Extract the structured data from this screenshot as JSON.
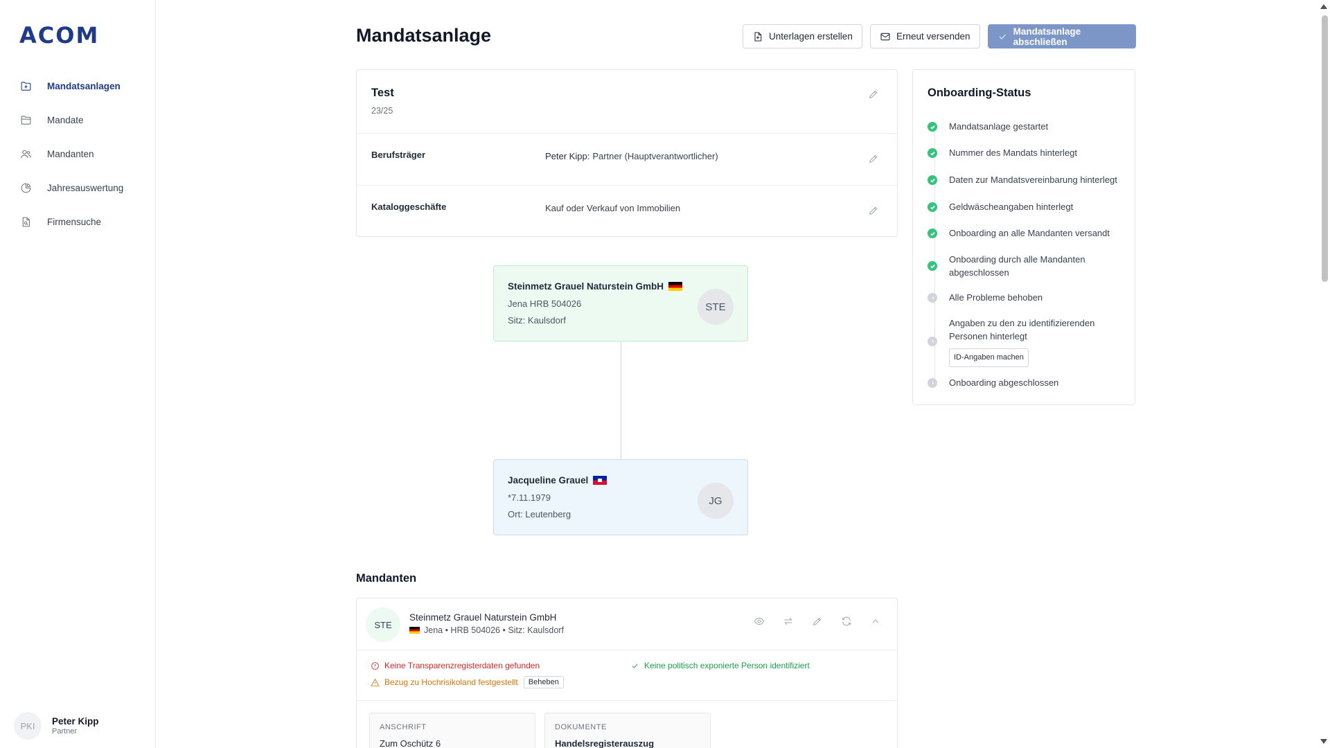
{
  "app": {
    "logo": "ACOM"
  },
  "sidebar": {
    "items": [
      {
        "label": "Mandatsanlagen",
        "icon": "folder-plus-icon",
        "active": true
      },
      {
        "label": "Mandate",
        "icon": "folder-icon"
      },
      {
        "label": "Mandanten",
        "icon": "users-icon"
      },
      {
        "label": "Jahresauswertung",
        "icon": "pie-chart-icon"
      },
      {
        "label": "Firmensuche",
        "icon": "document-search-icon"
      }
    ],
    "user": {
      "initials": "PKI",
      "name": "Peter Kipp",
      "role": "Partner"
    }
  },
  "header": {
    "title": "Mandatsanlage",
    "btn_create": "Unterlagen erstellen",
    "btn_resend": "Erneut versenden",
    "btn_finish": "Mandatsanlage abschließen"
  },
  "mandate": {
    "title": "Test",
    "number": "23/25",
    "rows": [
      {
        "label": "Berufsträger",
        "value_name": "Peter Kipp:",
        "value": "Partner (Hauptverantwortlicher)"
      },
      {
        "label": "Kataloggeschäfte",
        "value_name": "",
        "value": "Kauf oder Verkauf von Immobilien"
      }
    ]
  },
  "tree": {
    "company": {
      "name": "Steinmetz Grauel Naturstein GmbH",
      "line2": "Jena HRB 504026",
      "line3": "Sitz: Kaulsdorf",
      "initials": "STE",
      "flag": "DE"
    },
    "person": {
      "name": "Jacqueline Grauel",
      "line2": "*7.11.1979",
      "line3": "Ort: Leutenberg",
      "initials": "JG",
      "flag": "HT"
    }
  },
  "status": {
    "title": "Onboarding-Status",
    "items": [
      {
        "text": "Mandatsanlage gestartet",
        "done": true
      },
      {
        "text": "Nummer des Mandats hinterlegt",
        "done": true
      },
      {
        "text": "Daten zur Mandatsvereinbarung hinterlegt",
        "done": true
      },
      {
        "text": "Geldwäscheangaben hinterlegt",
        "done": true
      },
      {
        "text": "Onboarding an alle Mandanten versandt",
        "done": true
      },
      {
        "text": "Onboarding durch alle Mandanten abgeschlossen",
        "done": true
      },
      {
        "text": "Alle Probleme behoben",
        "done": false
      },
      {
        "text": "Angaben zu den zu identifizierenden Personen hinterlegt",
        "done": false,
        "button": "ID-Angaben machen"
      },
      {
        "text": "Onboarding abgeschlossen",
        "done": false
      }
    ]
  },
  "mandanten": {
    "title": "Mandanten",
    "item": {
      "initials": "STE",
      "name": "Steinmetz Grauel Naturstein GmbH",
      "meta": "Jena • HRB 504026 • Sitz: Kaulsdorf",
      "check_no_transparency": "Keine Transparenzregisterdaten gefunden",
      "check_high_risk": "Bezug zu Hochrisikoland festgestellt",
      "fix_button": "Beheben",
      "check_no_pep": "Keine politisch exponierte Person identifiziert",
      "address_header": "ANSCHRIFT",
      "address_value": "Zum Oschütz 6",
      "docs_header": "DOKUMENTE",
      "docs_value": "Handelsregisterauszug"
    }
  },
  "colors": {
    "brand": "#1e3a8a",
    "primary_button": "#7c96c8",
    "done": "#34c47c",
    "company_bg": "#ecfaf2",
    "person_bg": "#eef6fd"
  }
}
